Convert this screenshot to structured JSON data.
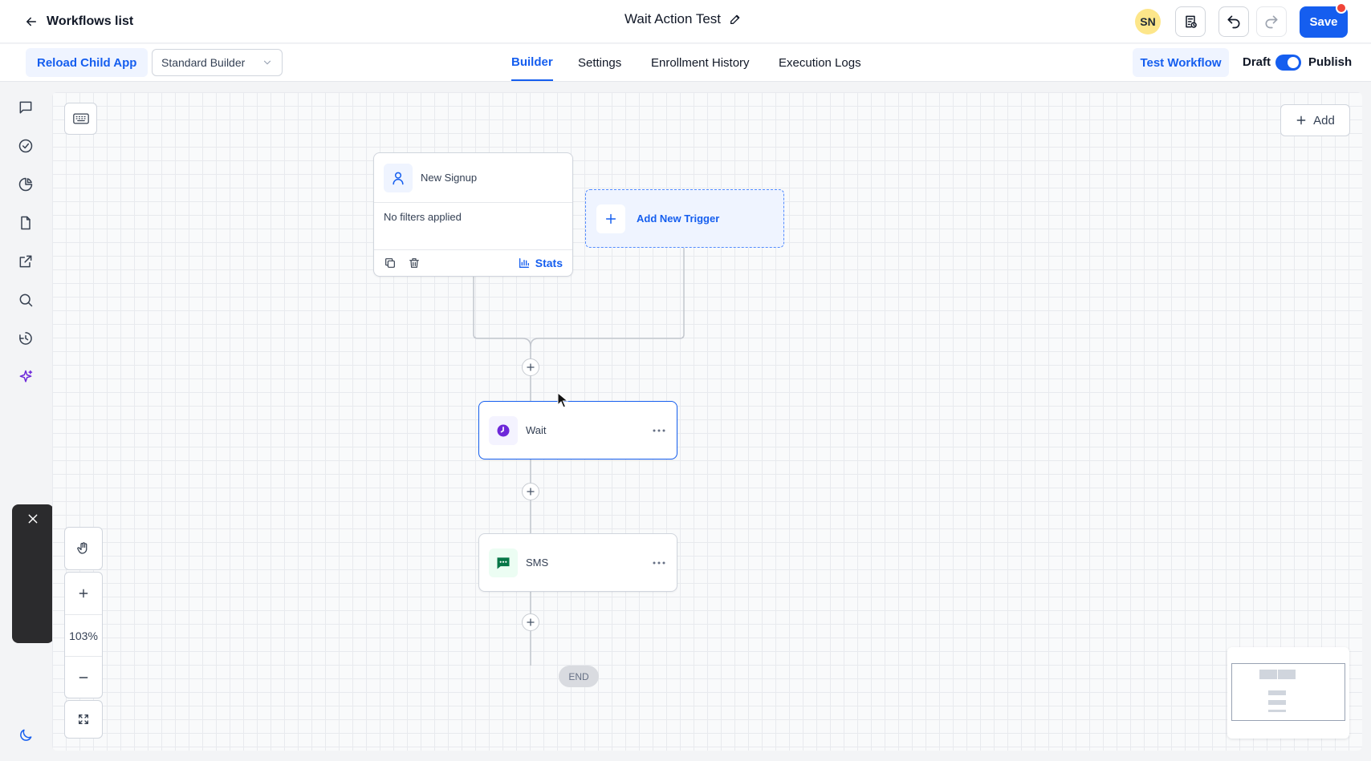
{
  "header": {
    "back_label": "Workflows list",
    "workflow_title": "Wait Action Test",
    "avatar_initials": "SN",
    "save_label": "Save"
  },
  "subbar": {
    "reload_label": "Reload Child App",
    "builder_selected": "Standard Builder",
    "tabs": [
      {
        "label": "Builder",
        "active": true
      },
      {
        "label": "Settings",
        "active": false
      },
      {
        "label": "Enrollment History",
        "active": false
      },
      {
        "label": "Execution Logs",
        "active": false
      }
    ],
    "test_label": "Test Workflow",
    "draft_label": "Draft",
    "publish_label": "Publish",
    "publish_toggle_on": true
  },
  "sidebar": {
    "icons": [
      "chat-icon",
      "check-circle-icon",
      "pie-chart-icon",
      "document-icon",
      "external-link-icon",
      "search-icon",
      "history-icon",
      "sparkle-icon",
      "moon-icon"
    ]
  },
  "canvas": {
    "add_label": "Add",
    "trigger": {
      "name": "New Signup",
      "filter_text": "No filters applied",
      "stats_label": "Stats"
    },
    "add_trigger_label": "Add New Trigger",
    "actions": [
      {
        "name": "Wait",
        "icon": "clock-icon",
        "color": "#6d28d9"
      },
      {
        "name": "SMS",
        "icon": "message-icon",
        "color": "#067647"
      }
    ],
    "end_label": "END",
    "zoom_level": "103%"
  },
  "colors": {
    "primary": "#155eef",
    "notification": "#f04438",
    "avatar_bg": "#fde68a"
  }
}
